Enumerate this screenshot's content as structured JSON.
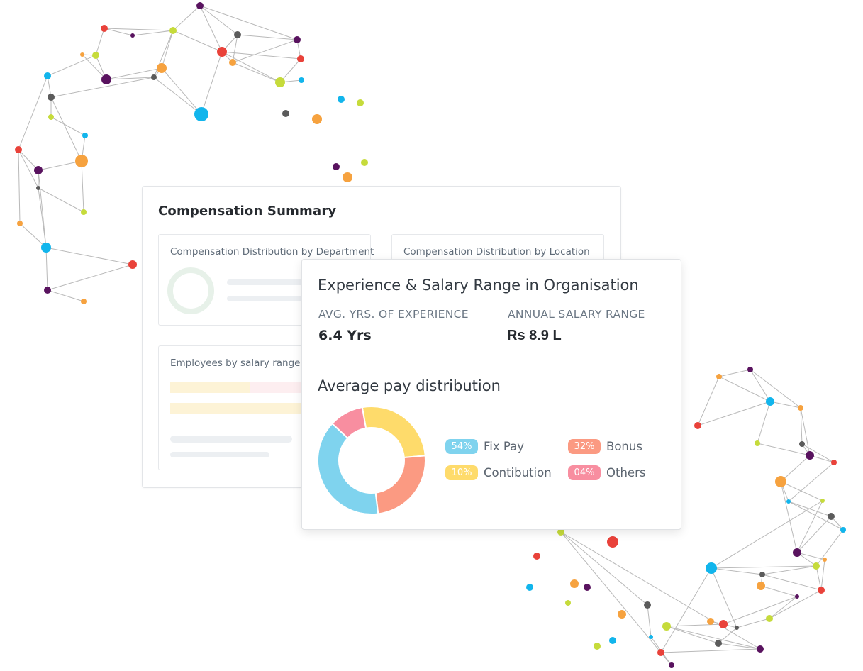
{
  "compensation_summary": {
    "title": "Compensation Summary",
    "panel_department": "Compensation Distribution by Department",
    "panel_location": "Compensation Distribution by Location",
    "panel_salary_range": "Employees by salary range"
  },
  "experience_card": {
    "title": "Experience & Salary Range in Organisation",
    "avg_experience_label": "AVG. YRS. OF EXPERIENCE",
    "avg_experience_value": "6.4 Yrs",
    "salary_range_label": "ANNUAL SALARY RANGE",
    "salary_range_value": "Rs 8.9 L",
    "distribution_title": "Average pay distribution",
    "legend": [
      {
        "pct": "54%",
        "label": "Fix Pay",
        "color": "#7fd3ee"
      },
      {
        "pct": "32%",
        "label": "Bonus",
        "color": "#fb9a82"
      },
      {
        "pct": "10%",
        "label": "Contibution",
        "color": "#fedb6b"
      },
      {
        "pct": "04%",
        "label": "Others",
        "color": "#f88ea0"
      }
    ]
  },
  "colors": {
    "node_palette": [
      "#e9423a",
      "#59135f",
      "#f6a23f",
      "#12b5ec",
      "#c6db3b",
      "#5b5b5b"
    ]
  }
}
